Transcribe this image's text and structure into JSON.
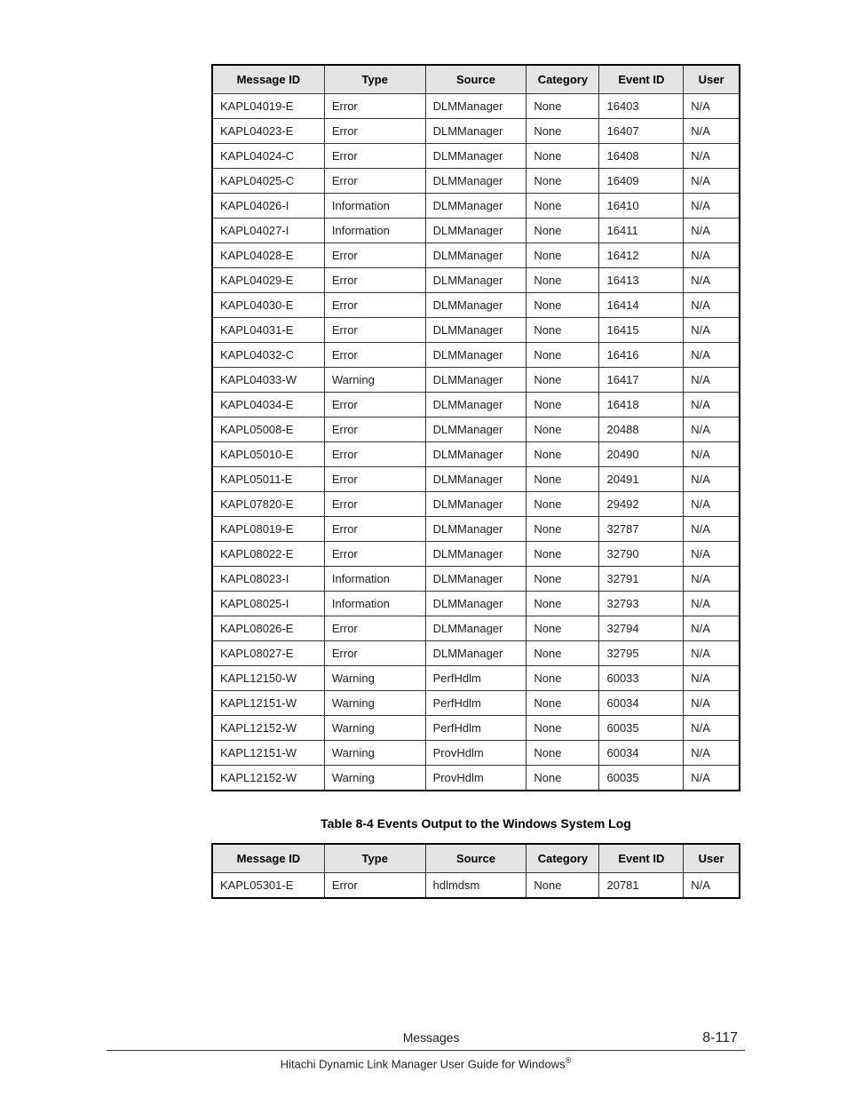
{
  "table1": {
    "headers": [
      "Message ID",
      "Type",
      "Source",
      "Category",
      "Event ID",
      "User"
    ],
    "rows": [
      [
        "KAPL04019-E",
        "Error",
        "DLMManager",
        "None",
        "16403",
        "N/A"
      ],
      [
        "KAPL04023-E",
        "Error",
        "DLMManager",
        "None",
        "16407",
        "N/A"
      ],
      [
        "KAPL04024-C",
        "Error",
        "DLMManager",
        "None",
        "16408",
        "N/A"
      ],
      [
        "KAPL04025-C",
        "Error",
        "DLMManager",
        "None",
        "16409",
        "N/A"
      ],
      [
        "KAPL04026-I",
        "Information",
        "DLMManager",
        "None",
        "16410",
        "N/A"
      ],
      [
        "KAPL04027-I",
        "Information",
        "DLMManager",
        "None",
        "16411",
        "N/A"
      ],
      [
        "KAPL04028-E",
        "Error",
        "DLMManager",
        "None",
        "16412",
        "N/A"
      ],
      [
        "KAPL04029-E",
        "Error",
        "DLMManager",
        "None",
        "16413",
        "N/A"
      ],
      [
        "KAPL04030-E",
        "Error",
        "DLMManager",
        "None",
        "16414",
        "N/A"
      ],
      [
        "KAPL04031-E",
        "Error",
        "DLMManager",
        "None",
        "16415",
        "N/A"
      ],
      [
        "KAPL04032-C",
        "Error",
        "DLMManager",
        "None",
        "16416",
        "N/A"
      ],
      [
        "KAPL04033-W",
        "Warning",
        "DLMManager",
        "None",
        "16417",
        "N/A"
      ],
      [
        "KAPL04034-E",
        "Error",
        "DLMManager",
        "None",
        "16418",
        "N/A"
      ],
      [
        "KAPL05008-E",
        "Error",
        "DLMManager",
        "None",
        "20488",
        "N/A"
      ],
      [
        "KAPL05010-E",
        "Error",
        "DLMManager",
        "None",
        "20490",
        "N/A"
      ],
      [
        "KAPL05011-E",
        "Error",
        "DLMManager",
        "None",
        "20491",
        "N/A"
      ],
      [
        "KAPL07820-E",
        "Error",
        "DLMManager",
        "None",
        "29492",
        "N/A"
      ],
      [
        "KAPL08019-E",
        "Error",
        "DLMManager",
        "None",
        "32787",
        "N/A"
      ],
      [
        "KAPL08022-E",
        "Error",
        "DLMManager",
        "None",
        "32790",
        "N/A"
      ],
      [
        "KAPL08023-I",
        "Information",
        "DLMManager",
        "None",
        "32791",
        "N/A"
      ],
      [
        "KAPL08025-I",
        "Information",
        "DLMManager",
        "None",
        "32793",
        "N/A"
      ],
      [
        "KAPL08026-E",
        "Error",
        "DLMManager",
        "None",
        "32794",
        "N/A"
      ],
      [
        "KAPL08027-E",
        "Error",
        "DLMManager",
        "None",
        "32795",
        "N/A"
      ],
      [
        "KAPL12150-W",
        "Warning",
        "PerfHdlm",
        "None",
        "60033",
        "N/A"
      ],
      [
        "KAPL12151-W",
        "Warning",
        "PerfHdlm",
        "None",
        "60034",
        "N/A"
      ],
      [
        "KAPL12152-W",
        "Warning",
        "PerfHdlm",
        "None",
        "60035",
        "N/A"
      ],
      [
        "KAPL12151-W",
        "Warning",
        "ProvHdlm",
        "None",
        "60034",
        "N/A"
      ],
      [
        "KAPL12152-W",
        "Warning",
        "ProvHdlm",
        "None",
        "60035",
        "N/A"
      ]
    ]
  },
  "table2_caption": "Table 8-4 Events Output to the Windows System Log",
  "table2": {
    "headers": [
      "Message ID",
      "Type",
      "Source",
      "Category",
      "Event ID",
      "User"
    ],
    "rows": [
      [
        "KAPL05301-E",
        "Error",
        "hdlmdsm",
        "None",
        "20781",
        "N/A"
      ]
    ]
  },
  "footer": {
    "center": "Messages",
    "page": "8-117",
    "bottom_prefix": "Hitachi Dynamic Link Manager User Guide for Windows",
    "reg": "®"
  }
}
